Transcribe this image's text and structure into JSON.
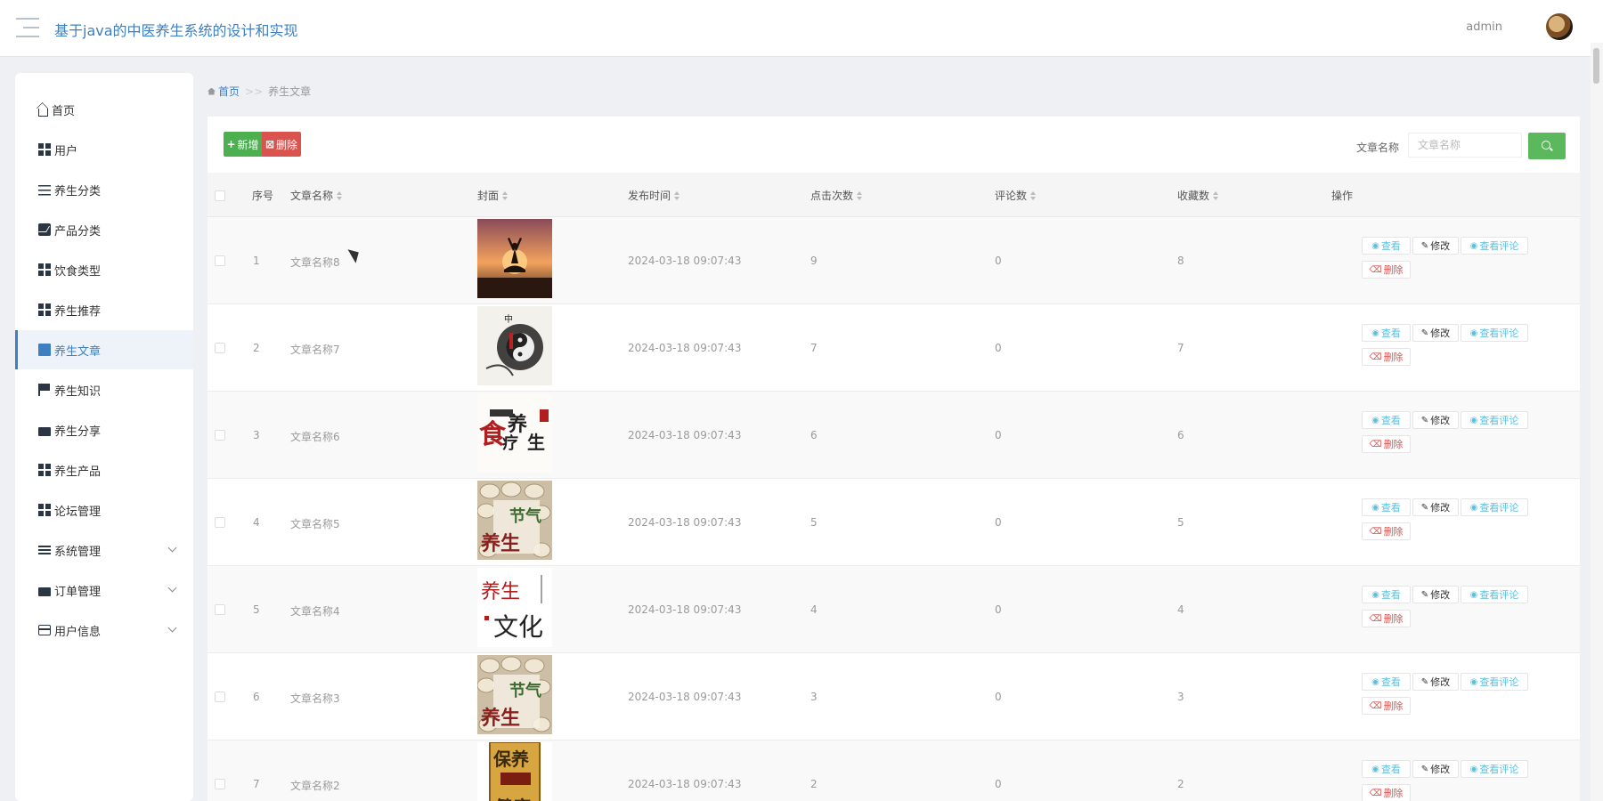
{
  "header": {
    "title": "基于java的中医养生系统的设计和实现",
    "user": "admin"
  },
  "sidebar": {
    "items": [
      {
        "label": "首页",
        "icon": "home-icon"
      },
      {
        "label": "用户",
        "icon": "grid-icon"
      },
      {
        "label": "养生分类",
        "icon": "sliders-icon"
      },
      {
        "label": "产品分类",
        "icon": "chart-icon"
      },
      {
        "label": "饮食类型",
        "icon": "grid-icon"
      },
      {
        "label": "养生推荐",
        "icon": "grid-icon"
      },
      {
        "label": "养生文章",
        "icon": "document-icon",
        "active": true
      },
      {
        "label": "养生知识",
        "icon": "flag-icon"
      },
      {
        "label": "养生分享",
        "icon": "share-icon"
      },
      {
        "label": "养生产品",
        "icon": "grid-icon"
      },
      {
        "label": "论坛管理",
        "icon": "grid-icon"
      },
      {
        "label": "系统管理",
        "icon": "list-icon",
        "expandable": true
      },
      {
        "label": "订单管理",
        "icon": "document-icon",
        "expandable": true
      },
      {
        "label": "用户信息",
        "icon": "card-icon",
        "expandable": true
      }
    ]
  },
  "breadcrumb": {
    "home": "首页",
    "separator": ">>",
    "current": "养生文章"
  },
  "toolbar": {
    "add_label": "新增",
    "delete_label": "删除",
    "search_label": "文章名称",
    "search_placeholder": "文章名称"
  },
  "table": {
    "headers": {
      "index": "序号",
      "name": "文章名称",
      "cover": "封面",
      "time": "发布时间",
      "clicks": "点击次数",
      "comments": "评论数",
      "favorites": "收藏数",
      "actions": "操作"
    },
    "actions": {
      "view": "查看",
      "edit": "修改",
      "comments": "查看评论",
      "delete": "删除"
    },
    "rows": [
      {
        "index": "1",
        "name": "文章名称8",
        "time": "2024-03-18 09:07:43",
        "clicks": "9",
        "comments": "0",
        "favorites": "8",
        "cover": "yoga-sunset"
      },
      {
        "index": "2",
        "name": "文章名称7",
        "time": "2024-03-18 09:07:43",
        "clicks": "7",
        "comments": "0",
        "favorites": "7",
        "cover": "ink-taiji"
      },
      {
        "index": "3",
        "name": "文章名称6",
        "time": "2024-03-18 09:07:43",
        "clicks": "6",
        "comments": "0",
        "favorites": "6",
        "cover": "calligraphy-red"
      },
      {
        "index": "4",
        "name": "文章名称5",
        "time": "2024-03-18 09:07:43",
        "clicks": "5",
        "comments": "0",
        "favorites": "5",
        "cover": "dumplings"
      },
      {
        "index": "5",
        "name": "文章名称4",
        "time": "2024-03-18 09:07:43",
        "clicks": "4",
        "comments": "0",
        "favorites": "4",
        "cover": "calligraphy-culture"
      },
      {
        "index": "6",
        "name": "文章名称3",
        "time": "2024-03-18 09:07:43",
        "clicks": "3",
        "comments": "0",
        "favorites": "3",
        "cover": "dumplings"
      },
      {
        "index": "7",
        "name": "文章名称2",
        "time": "2024-03-18 09:07:43",
        "clicks": "2",
        "comments": "0",
        "favorites": "2",
        "cover": "book-yellow"
      }
    ]
  }
}
